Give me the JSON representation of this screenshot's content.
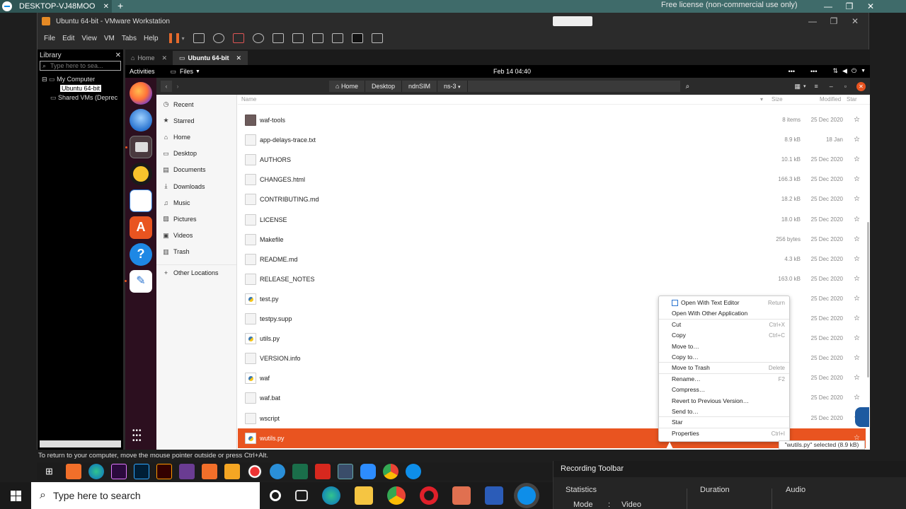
{
  "teamviewer": {
    "tab_label": "DESKTOP-VJ48MOO",
    "license_text": "Free license (non-commercial use only)"
  },
  "vmware": {
    "window_title": "Ubuntu 64-bit - VMware Workstation",
    "menu": [
      "File",
      "Edit",
      "View",
      "VM",
      "Tabs",
      "Help"
    ],
    "library": {
      "title": "Library",
      "search_placeholder": "Type here to sea...",
      "tree": [
        "My Computer",
        "Ubuntu 64-bit",
        "Shared VMs (Deprec"
      ]
    },
    "tabs": [
      {
        "label": "Home"
      },
      {
        "label": "Ubuntu 64-bit"
      }
    ],
    "hint": "To return to your computer, move the mouse pointer outside or press Ctrl+Alt."
  },
  "ubuntu": {
    "activities": "Activities",
    "app_menu": "Files",
    "clock": "Feb 14  04:40",
    "breadcrumb": [
      "Home",
      "Desktop",
      "ndnSIM",
      "ns-3"
    ],
    "sidebar": [
      {
        "label": "Recent",
        "icon": "clock-icon"
      },
      {
        "label": "Starred",
        "icon": "star-icon"
      },
      {
        "label": "Home",
        "icon": "home-icon"
      },
      {
        "label": "Desktop",
        "icon": "desktop-icon"
      },
      {
        "label": "Documents",
        "icon": "documents-icon"
      },
      {
        "label": "Downloads",
        "icon": "download-icon"
      },
      {
        "label": "Music",
        "icon": "music-icon"
      },
      {
        "label": "Pictures",
        "icon": "pictures-icon"
      },
      {
        "label": "Videos",
        "icon": "videos-icon"
      },
      {
        "label": "Trash",
        "icon": "trash-icon"
      },
      {
        "label": "Other Locations",
        "icon": "plus-icon"
      }
    ],
    "columns": {
      "name": "Name",
      "size": "Size",
      "modified": "Modified",
      "star": "Star"
    },
    "files": [
      {
        "name": "waf-tools",
        "size": "8 items",
        "modified": "25 Dec 2020",
        "type": "folder"
      },
      {
        "name": "app-delays-trace.txt",
        "size": "8.9 kB",
        "modified": "18 Jan",
        "type": "text"
      },
      {
        "name": "AUTHORS",
        "size": "10.1 kB",
        "modified": "25 Dec 2020",
        "type": "text"
      },
      {
        "name": "CHANGES.html",
        "size": "166.3 kB",
        "modified": "25 Dec 2020",
        "type": "html"
      },
      {
        "name": "CONTRIBUTING.md",
        "size": "18.2 kB",
        "modified": "25 Dec 2020",
        "type": "text"
      },
      {
        "name": "LICENSE",
        "size": "18.0 kB",
        "modified": "25 Dec 2020",
        "type": "text"
      },
      {
        "name": "Makefile",
        "size": "256 bytes",
        "modified": "25 Dec 2020",
        "type": "text"
      },
      {
        "name": "README.md",
        "size": "4.3 kB",
        "modified": "25 Dec 2020",
        "type": "text"
      },
      {
        "name": "RELEASE_NOTES",
        "size": "163.0 kB",
        "modified": "25 Dec 2020",
        "type": "text"
      },
      {
        "name": "test.py",
        "size": "",
        "modified": "25 Dec 2020",
        "type": "py"
      },
      {
        "name": "testpy.supp",
        "size": "",
        "modified": "25 Dec 2020",
        "type": "text"
      },
      {
        "name": "utils.py",
        "size": "",
        "modified": "25 Dec 2020",
        "type": "py"
      },
      {
        "name": "VERSION.info",
        "size": "",
        "modified": "25 Dec 2020",
        "type": "text"
      },
      {
        "name": "waf",
        "size": "",
        "modified": "25 Dec 2020",
        "type": "py"
      },
      {
        "name": "waf.bat",
        "size": "",
        "modified": "25 Dec 2020",
        "type": "text"
      },
      {
        "name": "wscript",
        "size": "",
        "modified": "25 Dec 2020",
        "type": "text"
      },
      {
        "name": "wutils.py",
        "size": "",
        "modified": "",
        "type": "py",
        "selected": true
      }
    ],
    "context_menu": [
      {
        "label": "Open With Text Editor",
        "shortcut": "Return"
      },
      {
        "label": "Open With Other Application",
        "shortcut": ""
      },
      {
        "label": "Cut",
        "shortcut": "Ctrl+X"
      },
      {
        "label": "Copy",
        "shortcut": "Ctrl+C"
      },
      {
        "label": "Move to…",
        "shortcut": ""
      },
      {
        "label": "Copy to…",
        "shortcut": ""
      },
      {
        "label": "Move to Trash",
        "shortcut": "Delete"
      },
      {
        "label": "Rename…",
        "shortcut": "F2"
      },
      {
        "label": "Compress…",
        "shortcut": ""
      },
      {
        "label": "Revert to Previous Version…",
        "shortcut": ""
      },
      {
        "label": "Send to…",
        "shortcut": ""
      },
      {
        "label": "Star",
        "shortcut": ""
      },
      {
        "label": "Properties",
        "shortcut": "Ctrl+I"
      }
    ],
    "status": "\"wutils.py\" selected  (8.9 kB)"
  },
  "recording_toolbar": {
    "title": "Recording Toolbar",
    "statistics": "Statistics",
    "duration": "Duration",
    "audio": "Audio",
    "mode_label": "Mode",
    "mode_sep": ":",
    "mode_value": "Video"
  },
  "windows": {
    "search_placeholder": "Type here to search"
  },
  "colors": {
    "accent": "#e95420",
    "dock": "#2c0f1f",
    "teamviewer_bar": "#3f6b6a"
  }
}
